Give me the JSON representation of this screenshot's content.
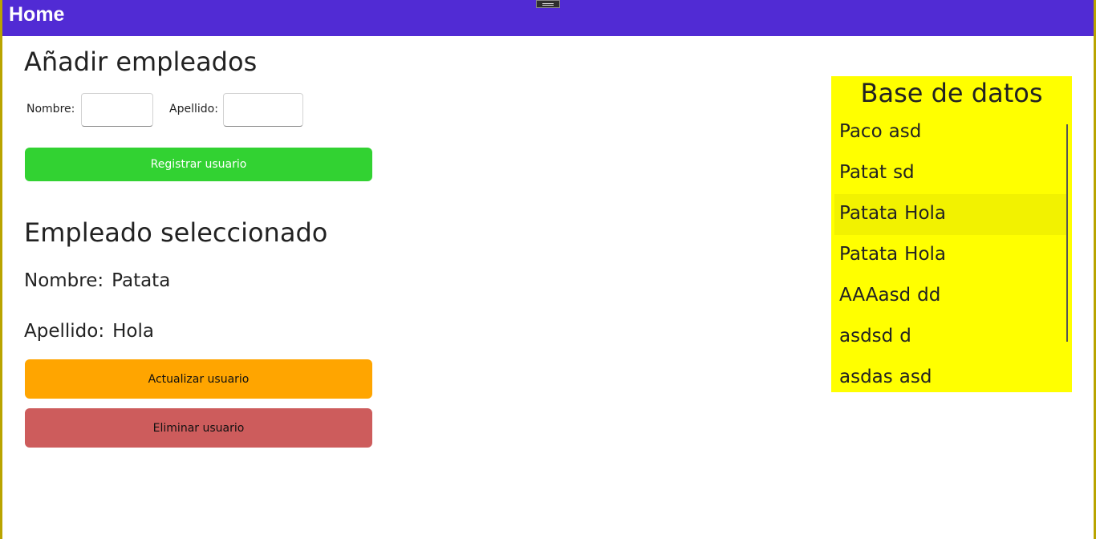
{
  "titlebar": {
    "title": "Home"
  },
  "add_section": {
    "heading": "Añadir empleados",
    "nombre_label": "Nombre:",
    "apellido_label": "Apellido:",
    "nombre_value": "",
    "apellido_value": "",
    "register_button": "Registrar usuario"
  },
  "selected_section": {
    "heading": "Empleado seleccionado",
    "nombre_label": "Nombre:",
    "nombre_value": "Patata",
    "apellido_label": "Apellido:",
    "apellido_value": "Hola",
    "update_button": "Actualizar usuario",
    "delete_button": "Eliminar usuario"
  },
  "database": {
    "title": "Base de datos",
    "selected_index": 2,
    "items": [
      {
        "nombre": "Paco",
        "apellido": "asd"
      },
      {
        "nombre": "Patat",
        "apellido": "sd"
      },
      {
        "nombre": "Patata",
        "apellido": "Hola"
      },
      {
        "nombre": "Patata",
        "apellido": "Hola"
      },
      {
        "nombre": "AAAasd",
        "apellido": "dd"
      },
      {
        "nombre": "asdsd",
        "apellido": "d"
      },
      {
        "nombre": "asdas",
        "apellido": "asd"
      }
    ]
  },
  "colors": {
    "titlebar": "#512bd4",
    "register": "#32d232",
    "update": "#ffa500",
    "delete": "#cd5c5c",
    "db_panel": "#ffff00"
  }
}
